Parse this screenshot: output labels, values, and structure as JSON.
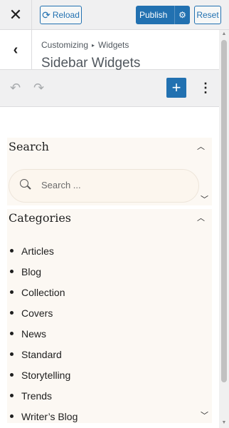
{
  "topbar": {
    "close_icon": "close-icon",
    "reload_label": "Reload",
    "publish_label": "Publish",
    "reset_label": "Reset"
  },
  "section": {
    "breadcrumb_parent": "Customizing",
    "breadcrumb_child": "Widgets",
    "title": "Sidebar Widgets"
  },
  "toolbar": {
    "add_glyph": "+",
    "more_glyph": "⋮"
  },
  "widgets": {
    "search": {
      "title": "Search",
      "placeholder": "Search ..."
    },
    "categories": {
      "title": "Categories",
      "items": [
        "Articles",
        "Blog",
        "Collection",
        "Covers",
        "News",
        "Standard",
        "Storytelling",
        "Trends",
        "Writer’s Blog"
      ]
    }
  },
  "colors": {
    "accent": "#2271b1",
    "widget_bg": "#fcf8f3"
  }
}
